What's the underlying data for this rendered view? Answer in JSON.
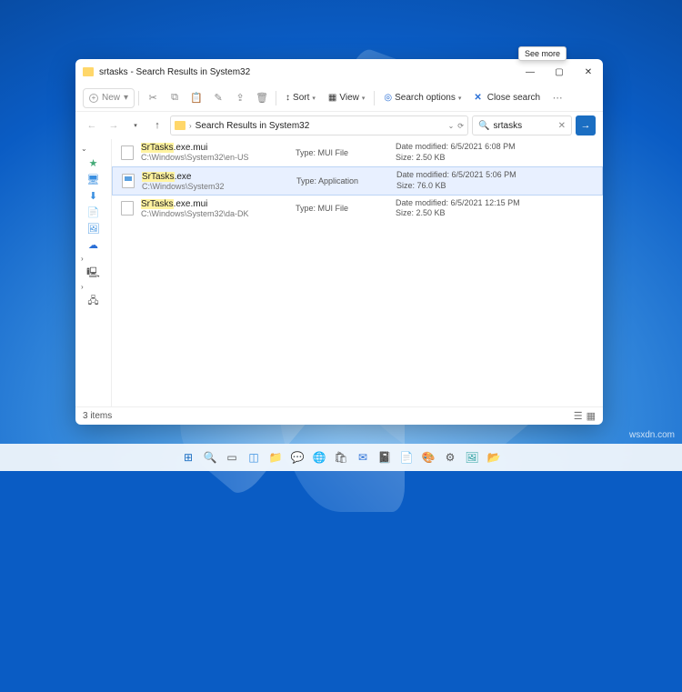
{
  "window": {
    "title": "srtasks - Search Results in System32",
    "seeMore": "See more"
  },
  "toolbar": {
    "new": "New",
    "sort": "Sort",
    "view": "View",
    "searchOptions": "Search options",
    "closeSearch": "Close search"
  },
  "address": {
    "location": "Search Results in System32",
    "searchValue": "srtasks"
  },
  "results": [
    {
      "nameHighlight": "SrTasks",
      "nameRest": ".exe.mui",
      "path": "C:\\Windows\\System32\\en-US",
      "typeLabel": "Type:",
      "type": "MUI File",
      "dateLabel": "Date modified:",
      "date": "6/5/2021 6:08 PM",
      "sizeLabel": "Size:",
      "size": "2.50 KB",
      "iconClass": "",
      "selected": false
    },
    {
      "nameHighlight": "SrTasks",
      "nameRest": ".exe",
      "path": "C:\\Windows\\System32",
      "typeLabel": "Type:",
      "type": "Application",
      "dateLabel": "Date modified:",
      "date": "6/5/2021 5:06 PM",
      "sizeLabel": "Size:",
      "size": "76.0 KB",
      "iconClass": "app",
      "selected": true
    },
    {
      "nameHighlight": "SrTasks",
      "nameRest": ".exe.mui",
      "path": "C:\\Windows\\System32\\da-DK",
      "typeLabel": "Type:",
      "type": "MUI File",
      "dateLabel": "Date modified:",
      "date": "6/5/2021 12:15 PM",
      "sizeLabel": "Size:",
      "size": "2.50 KB",
      "iconClass": "",
      "selected": false
    }
  ],
  "status": {
    "count": "3 items"
  },
  "taskbarIcons": [
    {
      "name": "start-icon",
      "glyph": "⊞",
      "color": "#1b6ec2"
    },
    {
      "name": "search-icon",
      "glyph": "🔍",
      "color": "#555"
    },
    {
      "name": "taskview-icon",
      "glyph": "▭",
      "color": "#555"
    },
    {
      "name": "widgets-icon",
      "glyph": "◫",
      "color": "#3a8fe0"
    },
    {
      "name": "explorer-icon",
      "glyph": "📁",
      "color": "#e9b949"
    },
    {
      "name": "teams-icon",
      "glyph": "💬",
      "color": "#6264a7"
    },
    {
      "name": "edge-icon",
      "glyph": "🌐",
      "color": "#1b9e77"
    },
    {
      "name": "store-icon",
      "glyph": "🛍",
      "color": "#555"
    },
    {
      "name": "mail-icon",
      "glyph": "✉",
      "color": "#2a6fd6"
    },
    {
      "name": "onenote-icon",
      "glyph": "📓",
      "color": "#7b2fa0"
    },
    {
      "name": "word-icon",
      "glyph": "📄",
      "color": "#2a6fd6"
    },
    {
      "name": "paint-icon",
      "glyph": "🎨",
      "color": "#d94f4f"
    },
    {
      "name": "settings-icon",
      "glyph": "⚙",
      "color": "#555"
    },
    {
      "name": "photos-icon",
      "glyph": "🖼",
      "color": "#2aa0a0"
    },
    {
      "name": "folder-icon",
      "glyph": "📂",
      "color": "#e9b949"
    }
  ],
  "watermark": "wsxdn.com"
}
